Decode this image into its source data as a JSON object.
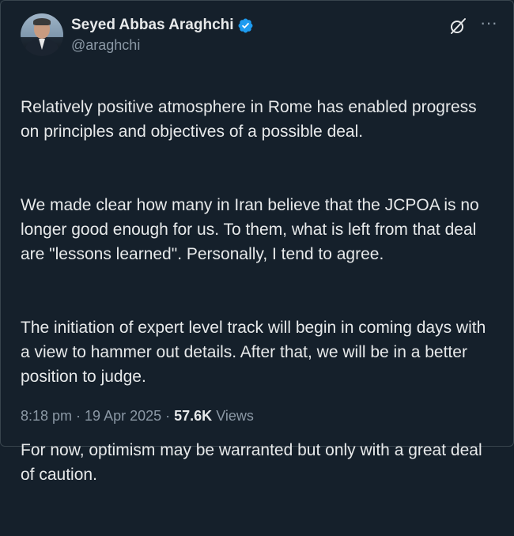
{
  "author": {
    "display_name": "Seyed Abbas Araghchi",
    "handle": "@araghchi",
    "verified": true
  },
  "icons": {
    "verified": "verified-badge-icon",
    "grok": "grok-icon",
    "more": "more-options-icon",
    "avatar": "profile-photo"
  },
  "colors": {
    "background": "#15202b",
    "text": "#e7e9ea",
    "secondary_text": "#8b98a5",
    "verified_badge": "#1d9bf0"
  },
  "tweet": {
    "paragraphs": [
      "Relatively positive atmosphere in Rome has enabled progress on principles and objectives of a possible deal.",
      "We made clear how many in Iran believe that the JCPOA is no longer good enough for us. To them, what is left from that deal are  \"lessons learned\". Personally, I tend to agree.",
      "The initiation of expert level track will begin in coming days with a view to hammer out details. After that, we will be in a better position to judge.",
      "For now, optimism may be warranted but only with a great deal of caution."
    ]
  },
  "meta": {
    "time": "8:18 pm",
    "separator": " · ",
    "date": "19 Apr 2025",
    "views_count": "57.6K",
    "views_label": " Views"
  }
}
